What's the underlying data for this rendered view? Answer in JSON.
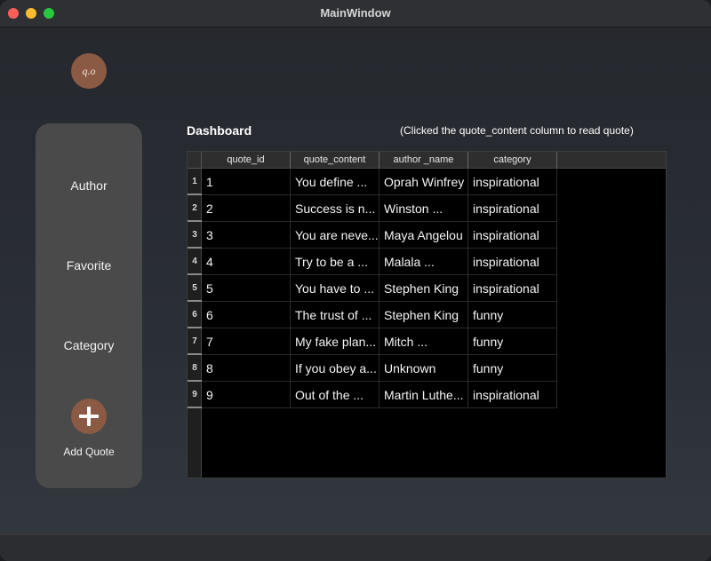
{
  "window": {
    "title": "MainWindow"
  },
  "logo": {
    "text": "q.o"
  },
  "sidebar": {
    "items": [
      {
        "label": "Author"
      },
      {
        "label": "Favorite"
      },
      {
        "label": "Category"
      }
    ],
    "add_label": "Add Quote",
    "add_icon": "plus-icon"
  },
  "dashboard": {
    "title": "Dashboard",
    "hint": "(Clicked the quote_content column to read quote)"
  },
  "table": {
    "columns": [
      "quote_id",
      "quote_content",
      "author _name",
      "category"
    ],
    "rows": [
      {
        "num": "1",
        "cells": [
          "1",
          "You define ...",
          "Oprah Winfrey",
          "inspirational"
        ]
      },
      {
        "num": "2",
        "cells": [
          "2",
          "Success is n...",
          "Winston ...",
          "inspirational"
        ]
      },
      {
        "num": "3",
        "cells": [
          "3",
          "You are neve...",
          "Maya Angelou",
          "inspirational"
        ]
      },
      {
        "num": "4",
        "cells": [
          "4",
          "Try to be a ...",
          "Malala ...",
          "inspirational"
        ]
      },
      {
        "num": "5",
        "cells": [
          "5",
          "You have to ...",
          "Stephen King",
          "inspirational"
        ]
      },
      {
        "num": "6",
        "cells": [
          "6",
          "The trust of ...",
          "Stephen King",
          "funny"
        ]
      },
      {
        "num": "7",
        "cells": [
          "7",
          "My fake plan...",
          "Mitch ...",
          "funny"
        ]
      },
      {
        "num": "8",
        "cells": [
          "8",
          "If you obey a...",
          "Unknown",
          "funny"
        ]
      },
      {
        "num": "9",
        "cells": [
          "9",
          "Out of the ...",
          "Martin Luthe...",
          "inspirational"
        ]
      }
    ]
  },
  "colors": {
    "accent": "#8a5a44",
    "sidebar_bg": "#4a4a4a",
    "table_bg": "#000000"
  }
}
